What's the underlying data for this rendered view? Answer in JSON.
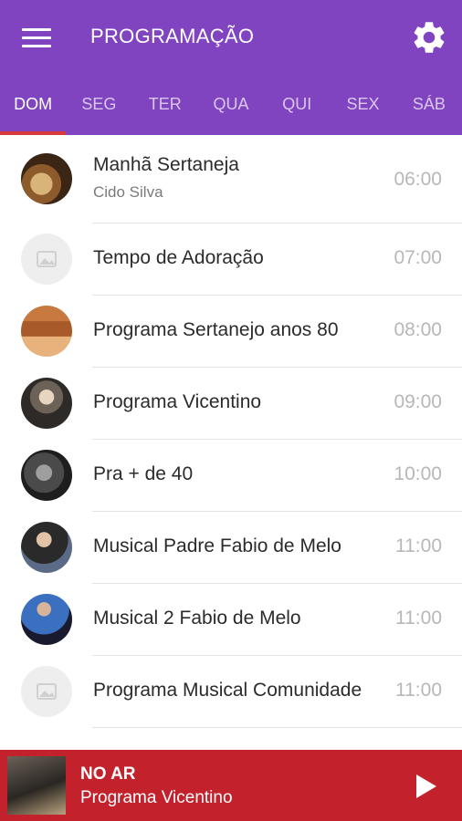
{
  "header": {
    "title": "PROGRAMAÇÃO",
    "menu_icon": "hamburger-menu-icon",
    "settings_icon": "gear-icon",
    "bar_color": "#8144c0"
  },
  "tabs": [
    {
      "label": "DOM",
      "active": true
    },
    {
      "label": "SEG",
      "active": false
    },
    {
      "label": "TER",
      "active": false
    },
    {
      "label": "QUA",
      "active": false
    },
    {
      "label": "QUI",
      "active": false
    },
    {
      "label": "SEX",
      "active": false
    },
    {
      "label": "SÁB",
      "active": false
    }
  ],
  "programs": [
    {
      "title": "Manhã Sertaneja",
      "host": "Cido Silva",
      "time": "06:00"
    },
    {
      "title": "Tempo de Adoração",
      "time": "07:00"
    },
    {
      "title": "Programa Sertanejo anos 80",
      "time": "08:00"
    },
    {
      "title": "Programa Vicentino",
      "time": "09:00"
    },
    {
      "title": "Pra + de 40",
      "time": "10:00"
    },
    {
      "title": "Musical Padre Fabio de Melo",
      "time": "11:00"
    },
    {
      "title": "Musical 2 Fabio de Melo",
      "time": "11:00"
    },
    {
      "title": "Programa Musical Comunidade",
      "time": "11:00"
    }
  ],
  "player": {
    "status": "NO AR",
    "program": "Programa Vicentino",
    "play_icon": "play-icon",
    "bar_color": "#c3212b"
  }
}
